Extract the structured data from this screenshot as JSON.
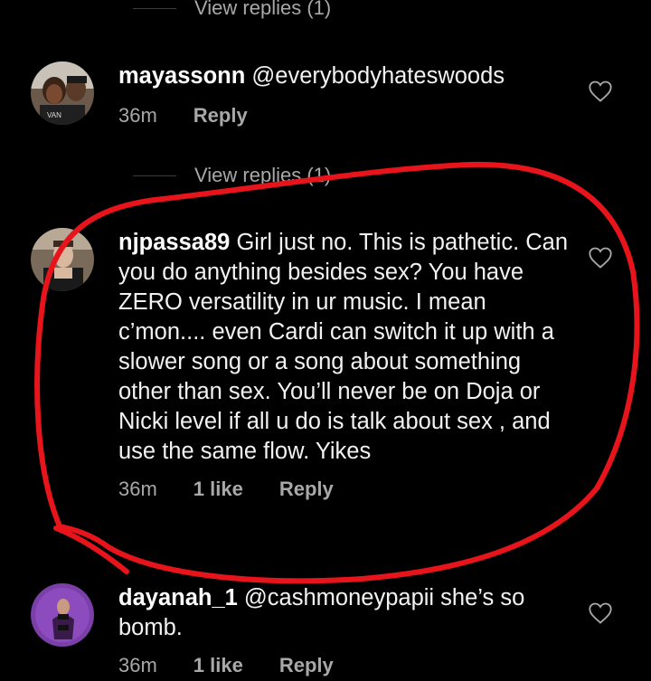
{
  "top_view_replies": "View replies (1)",
  "comments": [
    {
      "username": "mayassonn",
      "text": "@everybodyhateswoods",
      "time": "36m",
      "likes": "",
      "reply": "Reply",
      "view_replies": "View replies (1)"
    },
    {
      "username": "njpassa89",
      "text": "Girl just no. This is pathetic. Can you do anything besides sex? You have ZERO versatility in ur music. I mean c’mon.... even Cardi can switch it up with a slower song or a song about something other than sex. You’ll never be on Doja or Nicki level if all u do is talk about sex , and use the same flow. Yikes",
      "time": "36m",
      "likes": "1 like",
      "reply": "Reply"
    },
    {
      "username": "dayanah_1",
      "text": "@cashmoneypapii she’s so bomb.",
      "time": "36m",
      "likes": "1 like",
      "reply": "Reply"
    }
  ],
  "colors": {
    "background": "#000000",
    "secondary_text": "#a8a8a8",
    "annotation": "#e8141c"
  },
  "icons": [
    "heart-outline-icon"
  ]
}
